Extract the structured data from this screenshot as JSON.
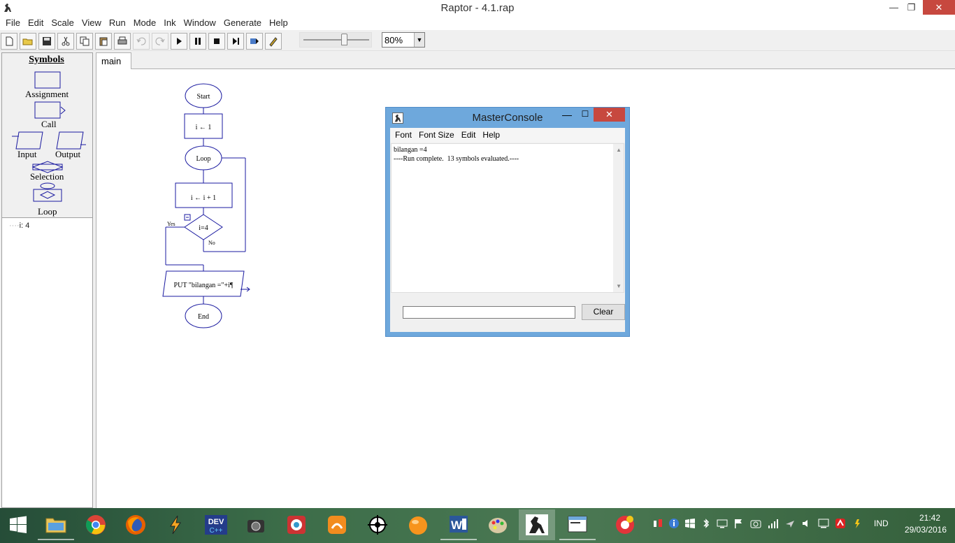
{
  "window": {
    "title": "Raptor - 4.1.rap"
  },
  "menu": [
    "File",
    "Edit",
    "Scale",
    "View",
    "Run",
    "Mode",
    "Ink",
    "Window",
    "Generate",
    "Help"
  ],
  "toolbar": {
    "zoom": "80%",
    "slider_value": 0.62
  },
  "symbols": {
    "title": "Symbols",
    "assignment": "Assignment",
    "call": "Call",
    "input": "Input",
    "output": "Output",
    "selection": "Selection",
    "loop": "Loop"
  },
  "variables": [
    "i: 4"
  ],
  "tab": {
    "label": "main"
  },
  "flowchart": {
    "start": "Start",
    "assign1": "i ← 1",
    "loop": "Loop",
    "assign2": "i ← i + 1",
    "condition": "i=4",
    "yes": "Yes",
    "no": "No",
    "output": "PUT \"bilangan =\"+i¶",
    "end": "End"
  },
  "console": {
    "title": "MasterConsole",
    "menu": [
      "Font",
      "Font Size",
      "Edit",
      "Help"
    ],
    "lines": [
      "bilangan =4",
      "----Run complete.  13 symbols evaluated.----"
    ],
    "clear_label": "Clear"
  },
  "taskbar": {
    "apps": [
      "start",
      "file-explorer",
      "chrome",
      "firefox",
      "winamp",
      "dev-cpp",
      "camera-app",
      "photo-app",
      "uc-browser",
      "target-app",
      "orange-app",
      "word",
      "paint",
      "raptor",
      "console-app",
      "extra-app"
    ],
    "language": "IND",
    "time": "21:42",
    "date": "29/03/2016"
  },
  "colors": {
    "flow_stroke": "#1a1aa0",
    "close_red": "#c7483f",
    "console_frame": "#6ea8dc"
  }
}
